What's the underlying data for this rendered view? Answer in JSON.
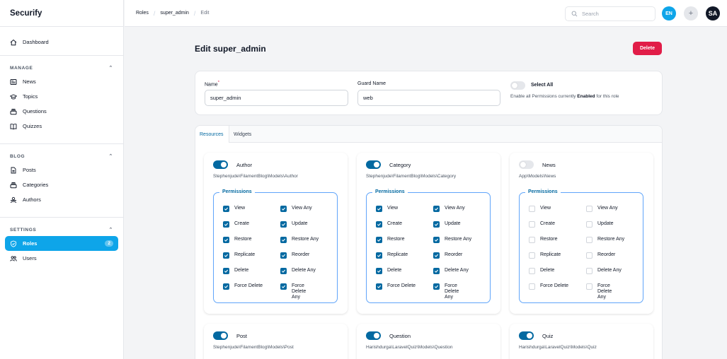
{
  "app": {
    "brand": "Securify"
  },
  "sidebar": {
    "dashboard": "Dashboard",
    "groups": [
      {
        "title": "MANAGE",
        "items": [
          "News",
          "Topics",
          "Questions",
          "Quizzes"
        ]
      },
      {
        "title": "BLOG",
        "items": [
          "Posts",
          "Categories",
          "Authors"
        ]
      },
      {
        "title": "SETTINGS",
        "items": [
          "Roles",
          "Users"
        ]
      }
    ],
    "roles_badge": "2"
  },
  "topbar": {
    "breadcrumb": [
      "Roles",
      "super_admin",
      "Edit"
    ],
    "search_placeholder": "Search",
    "lang": "EN",
    "plus": "+",
    "user_initials": "SA"
  },
  "page": {
    "title": "Edit super_admin",
    "delete_label": "Delete"
  },
  "form": {
    "name_label": "Name",
    "name_required": "*",
    "name_value": "super_admin",
    "guard_label": "Guard Name",
    "guard_value": "web",
    "select_all_label": "Select All",
    "select_all_help_pre": "Enable all Permissions currently ",
    "select_all_help_bold": "Enabled",
    "select_all_help_post": " for this role"
  },
  "tabs": [
    "Resources",
    "Widgets"
  ],
  "permissions_legend": "Permissions",
  "resources": [
    {
      "title": "Author",
      "model": "Stephenjude\\FilamentBlog\\Models\\Author",
      "enabled": true,
      "perms": [
        {
          "label": "View",
          "checked": true
        },
        {
          "label": "View Any",
          "checked": true
        },
        {
          "label": "Create",
          "checked": true
        },
        {
          "label": "Update",
          "checked": true
        },
        {
          "label": "Restore",
          "checked": true
        },
        {
          "label": "Restore Any",
          "checked": true
        },
        {
          "label": "Replicate",
          "checked": true
        },
        {
          "label": "Reorder",
          "checked": true
        },
        {
          "label": "Delete",
          "checked": true
        },
        {
          "label": "Delete Any",
          "checked": true
        },
        {
          "label": "Force Delete",
          "checked": true
        },
        {
          "label": "Force Delete Any",
          "checked": true
        }
      ]
    },
    {
      "title": "Category",
      "model": "Stephenjude\\FilamentBlog\\Models\\Category",
      "enabled": true,
      "perms": [
        {
          "label": "View",
          "checked": true
        },
        {
          "label": "View Any",
          "checked": true
        },
        {
          "label": "Create",
          "checked": true
        },
        {
          "label": "Update",
          "checked": true
        },
        {
          "label": "Restore",
          "checked": true
        },
        {
          "label": "Restore Any",
          "checked": true
        },
        {
          "label": "Replicate",
          "checked": true
        },
        {
          "label": "Reorder",
          "checked": true
        },
        {
          "label": "Delete",
          "checked": true
        },
        {
          "label": "Delete Any",
          "checked": true
        },
        {
          "label": "Force Delete",
          "checked": true
        },
        {
          "label": "Force Delete Any",
          "checked": true
        }
      ]
    },
    {
      "title": "News",
      "model": "App\\Models\\News",
      "enabled": false,
      "perms": [
        {
          "label": "View",
          "checked": false
        },
        {
          "label": "View Any",
          "checked": false
        },
        {
          "label": "Create",
          "checked": false
        },
        {
          "label": "Update",
          "checked": false
        },
        {
          "label": "Restore",
          "checked": false
        },
        {
          "label": "Restore Any",
          "checked": false
        },
        {
          "label": "Replicate",
          "checked": false
        },
        {
          "label": "Reorder",
          "checked": false
        },
        {
          "label": "Delete",
          "checked": false
        },
        {
          "label": "Delete Any",
          "checked": false
        },
        {
          "label": "Force Delete",
          "checked": false
        },
        {
          "label": "Force Delete Any",
          "checked": false
        }
      ]
    },
    {
      "title": "Post",
      "model": "Stephenjude\\FilamentBlog\\Models\\Post",
      "enabled": true
    },
    {
      "title": "Question",
      "model": "Harishdurga\\LaravelQuiz\\Models\\Question",
      "enabled": true
    },
    {
      "title": "Quiz",
      "model": "Harishdurga\\LaravelQuiz\\Models\\Quiz",
      "enabled": true
    }
  ],
  "colors": {
    "accent": "#0ea5e9",
    "primary": "#0369a1",
    "danger": "#e11d48"
  }
}
